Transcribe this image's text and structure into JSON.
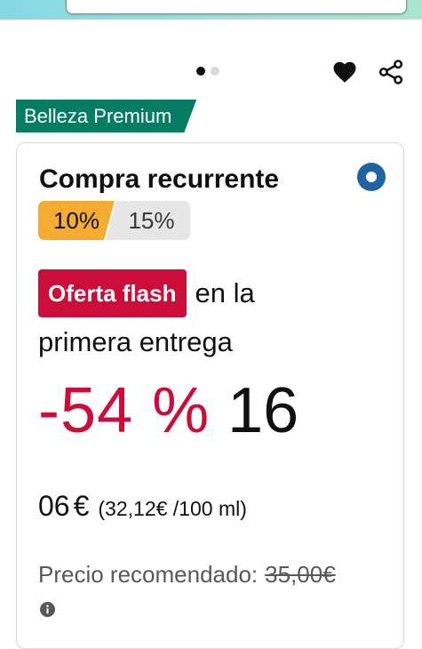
{
  "header": {
    "search": {
      "placeholder": ""
    }
  },
  "carousel": {
    "total_images": 2,
    "active_index": 0
  },
  "badge": {
    "label": "Belleza Premium",
    "color": "#067d62"
  },
  "subscribe_option": {
    "title": "Compra recurrente",
    "selected": true,
    "radio_color": "#2162a1",
    "discount_tiers": [
      {
        "label": "10%",
        "selected": true,
        "color": "#f6ac31"
      },
      {
        "label": "15%",
        "selected": false,
        "color": "#e6e6e6"
      }
    ],
    "flash_offer": {
      "badge": "Oferta flash",
      "text_line1": "en la",
      "text_line2": "primera entrega",
      "badge_color": "#cc0c39"
    },
    "price": {
      "discount": "-54 %",
      "whole": "16",
      "fraction": "06",
      "currency": "€",
      "unit_price": "(32,12€ /100 ml)",
      "discount_color": "#cc0c39"
    },
    "recommended_price": {
      "label": "Precio recomendado:",
      "value": "35,00€"
    }
  }
}
